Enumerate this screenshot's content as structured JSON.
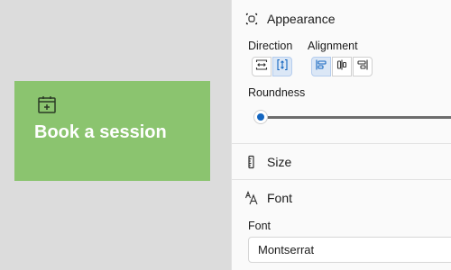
{
  "card": {
    "title": "Book a session",
    "icon": "calendar-add-icon",
    "color": "#8bc46f"
  },
  "panel": {
    "appearance": {
      "heading": "Appearance",
      "icon": "appearance-icon",
      "direction_label": "Direction",
      "alignment_label": "Alignment",
      "direction_options": [
        "horizontal",
        "vertical"
      ],
      "direction_selected": "vertical",
      "alignment_options": [
        "left",
        "center",
        "right"
      ],
      "alignment_selected": "left",
      "roundness_label": "Roundness",
      "roundness_value": 0
    },
    "size": {
      "heading": "Size",
      "icon": "ruler-icon"
    },
    "font": {
      "heading": "Font",
      "icon": "font-size-icon",
      "field_label": "Font",
      "value": "Montserrat"
    }
  },
  "colors": {
    "accent": "#1466c0",
    "selected_bg": "#dbe7f6"
  }
}
